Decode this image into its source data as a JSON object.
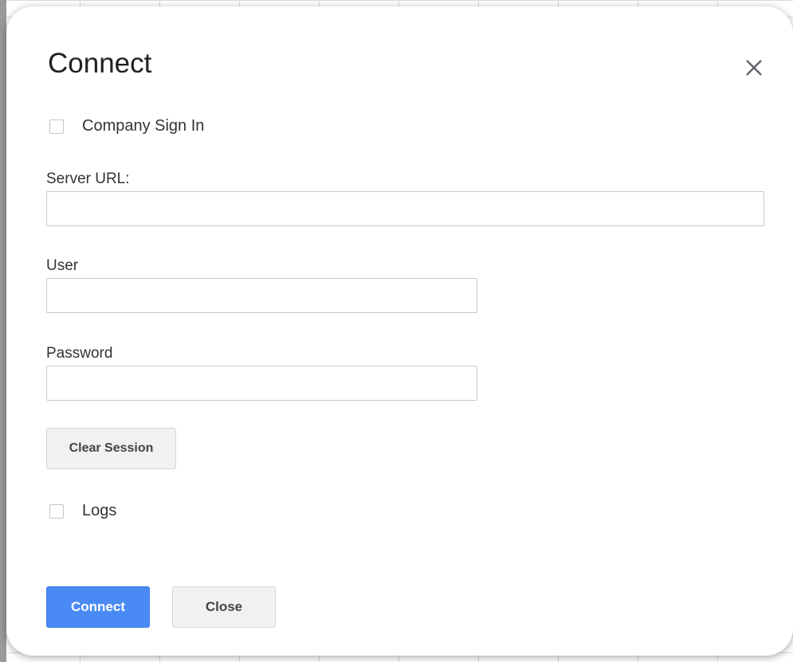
{
  "dialog": {
    "title": "Connect",
    "close_icon": "close-icon"
  },
  "company_sign_in": {
    "label": "Company Sign In",
    "checked": false
  },
  "server_url": {
    "label": "Server URL:",
    "value": ""
  },
  "user": {
    "label": "User",
    "value": ""
  },
  "password": {
    "label": "Password",
    "value": ""
  },
  "clear_session_label": "Clear Session",
  "logs": {
    "label": "Logs",
    "checked": false
  },
  "footer": {
    "connect_label": "Connect",
    "close_label": "Close"
  },
  "colors": {
    "primary_button": "#4a8af4"
  }
}
